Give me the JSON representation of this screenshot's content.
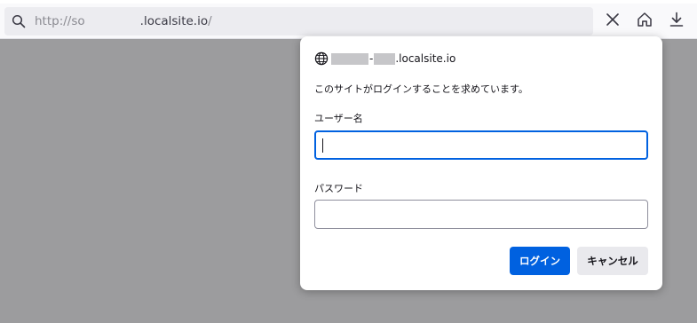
{
  "toolbar": {
    "url": {
      "prefix": "http://so",
      "host": ".localsite.io",
      "suffix": "/"
    },
    "icons": {
      "search": "search-icon",
      "stop": "close-icon",
      "home": "home-icon",
      "download": "download-icon"
    }
  },
  "dialog": {
    "origin": {
      "dash": "-",
      "host": ".localsite.io"
    },
    "prompt": "このサイトがログインすることを求めています。",
    "username_label": "ユーザー名",
    "username_value": "",
    "password_label": "パスワード",
    "password_value": "",
    "login_button": "ログイン",
    "cancel_button": "キャンセル"
  },
  "colors": {
    "accent": "#0061e0",
    "backdrop": "#9c9c9e",
    "toolbar": "#f9f9fb",
    "urlbar": "#ececf0"
  }
}
